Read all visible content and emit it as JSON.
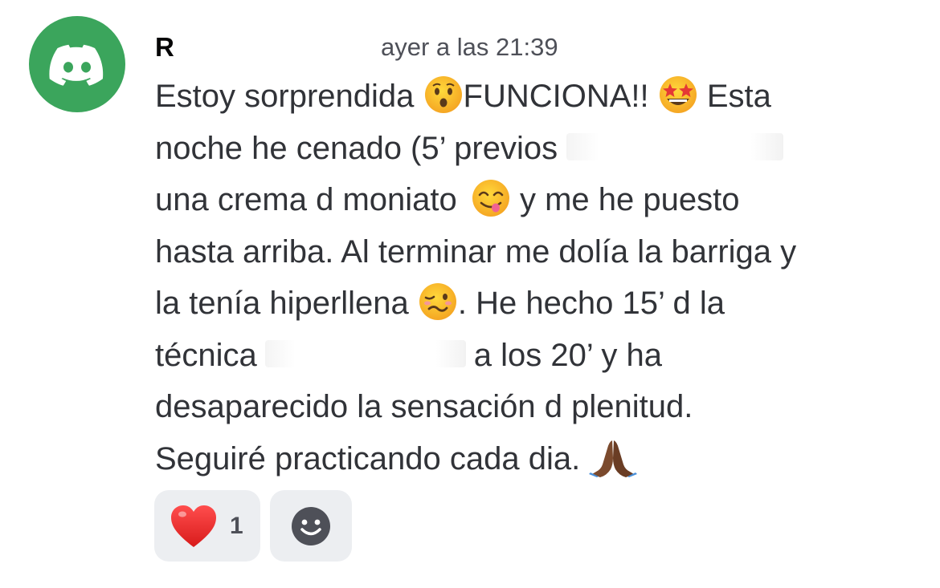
{
  "message": {
    "author": {
      "name": "R",
      "avatar_icon": "discord-logo-icon",
      "avatar_color": "#3ba55c"
    },
    "timestamp": "ayer a las 21:39",
    "lines": [
      {
        "a": "Estoy sorprendida ",
        "b": "FUNCIONA!! ",
        "c": " Esta"
      },
      {
        "a": "noche he cenado (5’ previos "
      },
      {
        "a": "una crema d moniato ",
        "b": " y me he puesto"
      },
      {
        "a": "hasta arriba. Al terminar me dolía la barriga y"
      },
      {
        "a": "la tenía hiperllena ",
        "b": ". He hecho 15’ d la"
      },
      {
        "a": "técnica",
        "b": "a los 20’ y ha"
      },
      {
        "a": "desaparecido la sensación d plenitud."
      },
      {
        "a": "Seguiré practicando cada dia. "
      }
    ],
    "emojis": [
      "hushed-face-icon",
      "star-struck-icon",
      "yum-face-icon",
      "woozy-face-icon",
      "folded-hands-icon"
    ]
  },
  "reactions": [
    {
      "emoji": "red-heart-icon",
      "count": "1"
    },
    {
      "emoji": "add-reaction-smiley-icon"
    }
  ],
  "colors": {
    "reaction_bg": "#eceef1",
    "text": "#313338",
    "muted": "#4e5058"
  }
}
